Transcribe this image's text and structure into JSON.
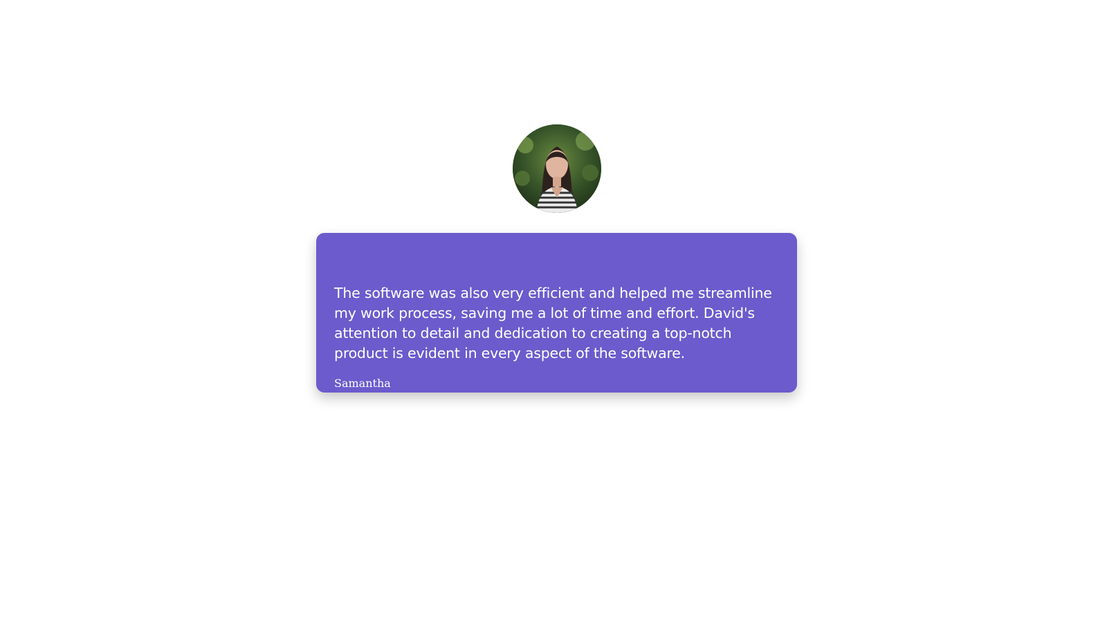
{
  "testimonial": {
    "text": "The software was also very efficient and helped me streamline my work process, saving me a lot of time and effort. David's attention to detail and dedication to creating a top-notch product is evident in every aspect of the software.",
    "author": "Samantha",
    "avatar_icon": "profile-photo",
    "card_color": "#6b5bcc"
  }
}
